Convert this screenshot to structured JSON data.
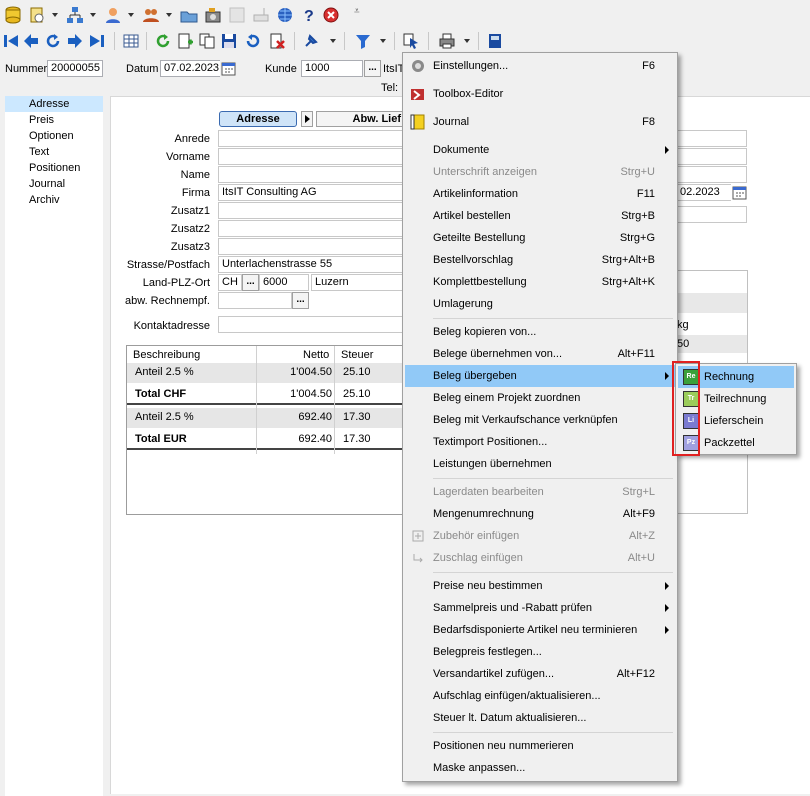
{
  "toolbar_top": {
    "icons": [
      "database-icon",
      "document-config-icon",
      "hierarchy-icon",
      "user-icon",
      "users-icon",
      "folder-open-icon",
      "camera-icon",
      "blank-icon",
      "scanner-icon",
      "globe-icon",
      "help-icon",
      "close-circle-icon",
      "dropdown-icon"
    ]
  },
  "toolbar_nav": {
    "icons": [
      "first-record-icon",
      "prev-record-icon",
      "refresh-icon",
      "next-record-icon",
      "last-record-icon",
      "table-icon",
      "reload-icon",
      "new-doc-icon",
      "copy-icon",
      "save-icon",
      "undo-icon",
      "delete-icon",
      "pin-icon",
      "filter-icon",
      "pointer-icon",
      "print-icon",
      "calculator-icon"
    ]
  },
  "header": {
    "nummer_label": "Nummer",
    "nummer_value": "20000055",
    "datum_label": "Datum",
    "datum_value": "07.02.2023",
    "kunde_label": "Kunde",
    "kunde_value": "1000",
    "kunde_name": "ItsIT",
    "tel_label": "Tel:",
    "ellipsis": "..."
  },
  "nav": {
    "items": [
      "Adresse",
      "Preis",
      "Optionen",
      "Text",
      "Positionen",
      "Journal",
      "Archiv"
    ],
    "selected": "Adresse"
  },
  "tabs": {
    "adresse": "Adresse",
    "abw_lief": "Abw. Lief"
  },
  "form": {
    "anrede_label": "Anrede",
    "vorname_label": "Vorname",
    "name_label": "Name",
    "firma_label": "Firma",
    "firma_value": "ItsIT Consulting AG",
    "zusatz1_label": "Zusatz1",
    "zusatz2_label": "Zusatz2",
    "zusatz3_label": "Zusatz3",
    "strasse_label": "Strasse/Postfach",
    "strasse_value": "Unterlachenstrasse 55",
    "land_label": "Land-PLZ-Ort",
    "land_value": "CH",
    "plz_value": "6000",
    "ort_value": "Luzern",
    "rechnempf_label": "abw. Rechnempf.",
    "kontakt_label": "Kontaktadresse",
    "right_date": "02.2023",
    "right_cell1": "kg",
    "right_cell2": "50"
  },
  "grid": {
    "columns": [
      "Beschreibung",
      "Netto",
      "Steuer"
    ],
    "rows": [
      {
        "beschreibung": "Anteil 2.5 %",
        "netto": "1'004.50",
        "steuer": "25.10",
        "bold": false
      },
      {
        "beschreibung": "Total CHF",
        "netto": "1'004.50",
        "steuer": "25.10",
        "bold": true
      },
      {
        "beschreibung": "Anteil 2.5 %",
        "netto": "692.40",
        "steuer": "17.30",
        "bold": false
      },
      {
        "beschreibung": "Total EUR",
        "netto": "692.40",
        "steuer": "17.30",
        "bold": true
      }
    ]
  },
  "menu": {
    "items": [
      {
        "label": "Einstellungen...",
        "shortcut": "F6",
        "icon": "settings-icon"
      },
      {
        "label": "Toolbox-Editor",
        "shortcut": "",
        "icon": "toolbox-icon"
      },
      {
        "label": "Journal",
        "shortcut": "F8",
        "icon": "journal-icon"
      },
      {
        "label": "Dokumente",
        "shortcut": ""
      },
      {
        "label": "Unterschrift anzeigen",
        "shortcut": "Strg+U"
      },
      {
        "label": "Artikelinformation",
        "shortcut": "F11"
      },
      {
        "label": "Artikel bestellen",
        "shortcut": "Strg+B"
      },
      {
        "label": "Geteilte Bestellung",
        "shortcut": "Strg+G"
      },
      {
        "label": "Bestellvorschlag",
        "shortcut": "Strg+Alt+B"
      },
      {
        "label": "Komplettbestellung",
        "shortcut": "Strg+Alt+K"
      },
      {
        "label": "Umlagerung",
        "shortcut": ""
      },
      {
        "label": "Beleg kopieren von...",
        "shortcut": ""
      },
      {
        "label": "Belege übernehmen von...",
        "shortcut": "Alt+F11"
      },
      {
        "label": "Beleg übergeben",
        "shortcut": ""
      },
      {
        "label": "Beleg einem Projekt zuordnen",
        "shortcut": ""
      },
      {
        "label": "Beleg mit Verkaufschance verknüpfen",
        "shortcut": ""
      },
      {
        "label": "Textimport Positionen...",
        "shortcut": ""
      },
      {
        "label": "Leistungen übernehmen",
        "shortcut": ""
      },
      {
        "label": "Lagerdaten bearbeiten",
        "shortcut": "Strg+L"
      },
      {
        "label": "Mengenumrechnung",
        "shortcut": "Alt+F9"
      },
      {
        "label": "Zubehör einfügen",
        "shortcut": "Alt+Z",
        "icon": "add-accessory-icon"
      },
      {
        "label": "Zuschlag einfügen",
        "shortcut": "Alt+U",
        "icon": "surcharge-icon"
      },
      {
        "label": "Preise neu bestimmen",
        "shortcut": ""
      },
      {
        "label": "Sammelpreis und -Rabatt prüfen",
        "shortcut": ""
      },
      {
        "label": "Bedarfsdisponierte Artikel neu terminieren",
        "shortcut": ""
      },
      {
        "label": "Belegpreis festlegen...",
        "shortcut": ""
      },
      {
        "label": "Versandartikel zufügen...",
        "shortcut": "Alt+F12"
      },
      {
        "label": "Aufschlag einfügen/aktualisieren...",
        "shortcut": ""
      },
      {
        "label": "Steuer lt. Datum aktualisieren...",
        "shortcut": ""
      },
      {
        "label": "Positionen neu nummerieren",
        "shortcut": ""
      },
      {
        "label": "Maske anpassen...",
        "shortcut": ""
      }
    ]
  },
  "submenu": {
    "items": [
      {
        "label": "Rechnung",
        "icon_text": "Re",
        "color": "#3aa03a"
      },
      {
        "label": "Teilrechnung",
        "icon_text": "Tr",
        "color": "#9bcc5a"
      },
      {
        "label": "Lieferschein",
        "icon_text": "Li",
        "color": "#7a7ad0"
      },
      {
        "label": "Packzettel",
        "icon_text": "Pz",
        "color": "#a0a0e0"
      }
    ]
  },
  "colors": {
    "highlight": "#91c9f7",
    "nav_selected": "#cce8ff",
    "red_box": "#e02020"
  }
}
